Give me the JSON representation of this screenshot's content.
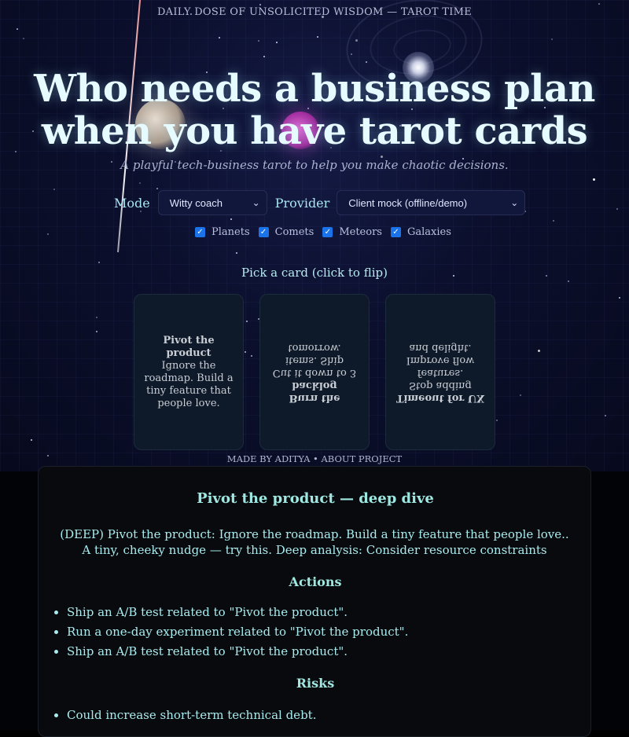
{
  "header": {
    "tagline": "DAILY DOSE OF UNSOLICITED WISDOM — TAROT TIME",
    "headline_line1": "Who needs a business plan",
    "headline_line2": "when you have tarot cards",
    "subtitle": "A playful tech-business tarot to help you make chaotic decisions."
  },
  "controls": {
    "mode_label": "Mode",
    "mode_value": "Witty coach",
    "provider_label": "Provider",
    "provider_value": "Client mock (offline/demo)"
  },
  "toggles": [
    {
      "label": "Planets",
      "checked": true
    },
    {
      "label": "Comets",
      "checked": true
    },
    {
      "label": "Meteors",
      "checked": true
    },
    {
      "label": "Galaxies",
      "checked": true
    }
  ],
  "cards_prompt": "Pick a card (click to flip)",
  "cards": [
    {
      "title": "Pivot the product",
      "body": "Ignore the roadmap. Build a tiny feature that people love.",
      "orientation": "upright"
    },
    {
      "title": "Burn the backlog",
      "body": "Cut it down to 3 items. Ship tomorrow.",
      "orientation": "reversed"
    },
    {
      "title": "Timeout for UX",
      "body": "Stop adding features. Improve flow and delight.",
      "orientation": "reversed"
    }
  ],
  "footer": "MADE BY ADITYA • ABOUT PROJECT",
  "detail": {
    "title": "Pivot the product — deep dive",
    "description": "(DEEP) Pivot the product: Ignore the roadmap. Build a tiny feature that people love.. A tiny, cheeky nudge — try this. Deep analysis: Consider resource constraints",
    "actions_heading": "Actions",
    "actions": [
      "Ship an A/B test related to \"Pivot the product\".",
      "Run a one-day experiment related to \"Pivot the product\".",
      "Ship an A/B test related to \"Pivot the product\"."
    ],
    "risks_heading": "Risks",
    "risks": [
      "Could increase short-term technical debt."
    ]
  },
  "colors": {
    "headline": "#e6fbff",
    "accent_teal": "#9fe8e2",
    "checkbox": "#1a73e8",
    "sky_dark": "#070a1e"
  }
}
